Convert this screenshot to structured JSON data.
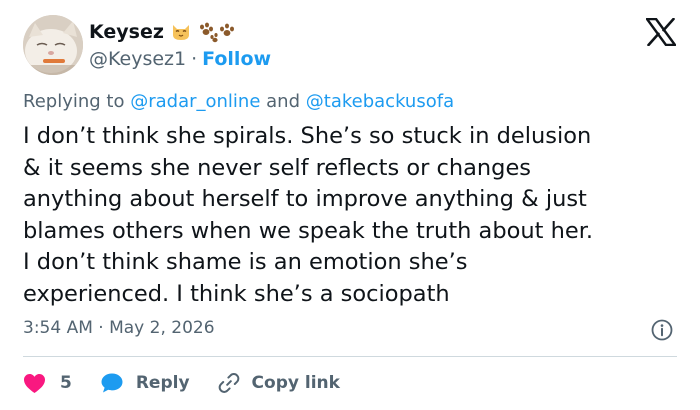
{
  "author": {
    "display_name": "Keysez",
    "handle": "@Keysez1",
    "separator": "·",
    "follow_label": "Follow"
  },
  "icons": {
    "avatar": "cat-photo-avatar",
    "name_emoji_1": "cat-face-emoji",
    "name_emoji_2": "paw-prints-emoji",
    "platform": "x-logo-icon",
    "info": "info-icon",
    "like": "heart-icon",
    "reply": "reply-bubble-icon",
    "copy": "link-icon"
  },
  "replying": {
    "prefix": "Replying to",
    "user1": "@radar_online",
    "conjunction": "and",
    "user2": "@takebackusofa"
  },
  "tweet": {
    "lines": [
      "I don’t think she spirals. She’s so stuck in delusion",
      "& it seems she never self reflects or changes",
      "anything about herself to improve anything & just",
      "blames others when we speak the truth about her.",
      "I don’t think shame is an emotion she’s",
      "experienced. I think she’s a sociopath"
    ],
    "timestamp": "3:54 AM · May 2, 2026"
  },
  "actions": {
    "like_count": "5",
    "reply_label": "Reply",
    "copy_label": "Copy link"
  },
  "colors": {
    "accent": "#1d9bf0",
    "like": "#f91880",
    "text_primary": "#0f1419",
    "text_secondary": "#536471",
    "divider": "#cfd9de"
  }
}
